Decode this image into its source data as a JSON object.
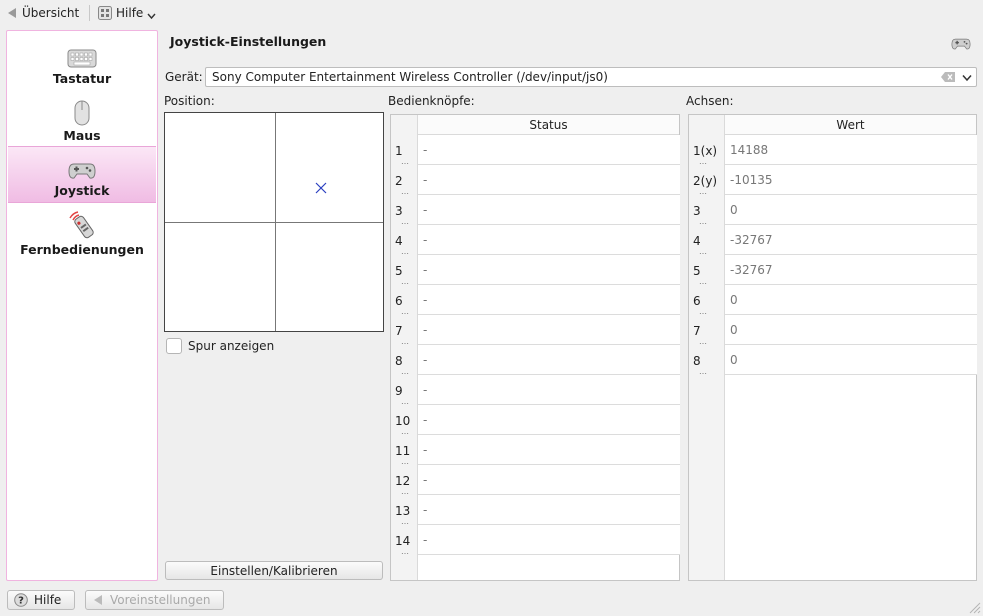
{
  "toolbar": {
    "overview_label": "Übersicht",
    "help_label": "Hilfe"
  },
  "sidebar": {
    "items": [
      {
        "label": "Tastatur",
        "icon": "keyboard-icon"
      },
      {
        "label": "Maus",
        "icon": "mouse-icon"
      },
      {
        "label": "Joystick",
        "icon": "gamepad-icon",
        "active": true
      },
      {
        "label": "Fernbedienungen",
        "icon": "remote-control-icon"
      }
    ]
  },
  "header": {
    "title": "Joystick-Einstellungen"
  },
  "device": {
    "label": "Gerät:",
    "value": "Sony Computer Entertainment Wireless Controller (/dev/input/js0)"
  },
  "position": {
    "label": "Position:",
    "show_trace_label": "Spur anzeigen",
    "calibrate_label": "Einstellen/Kalibrieren"
  },
  "buttons": {
    "label": "Bedienknöpfe:",
    "column": "Status",
    "rows": [
      {
        "num": "1",
        "value": "-"
      },
      {
        "num": "2",
        "value": "-"
      },
      {
        "num": "3",
        "value": "-"
      },
      {
        "num": "4",
        "value": "-"
      },
      {
        "num": "5",
        "value": "-"
      },
      {
        "num": "6",
        "value": "-"
      },
      {
        "num": "7",
        "value": "-"
      },
      {
        "num": "8",
        "value": "-"
      },
      {
        "num": "9",
        "value": "-"
      },
      {
        "num": "10",
        "value": "-"
      },
      {
        "num": "11",
        "value": "-"
      },
      {
        "num": "12",
        "value": "-"
      },
      {
        "num": "13",
        "value": "-"
      },
      {
        "num": "14",
        "value": "-"
      }
    ]
  },
  "axes": {
    "label": "Achsen:",
    "column": "Wert",
    "rows": [
      {
        "num": "1(x)",
        "value": "14188"
      },
      {
        "num": "2(y)",
        "value": "-10135"
      },
      {
        "num": "3",
        "value": "0"
      },
      {
        "num": "4",
        "value": "-32767"
      },
      {
        "num": "5",
        "value": "-32767"
      },
      {
        "num": "6",
        "value": "0"
      },
      {
        "num": "7",
        "value": "0"
      },
      {
        "num": "8",
        "value": "0"
      }
    ]
  },
  "footer": {
    "help_label": "Hilfe",
    "defaults_label": "Voreinstellungen"
  },
  "colors": {
    "accent": "#f0bce4",
    "marker": "#2a3fc0"
  }
}
